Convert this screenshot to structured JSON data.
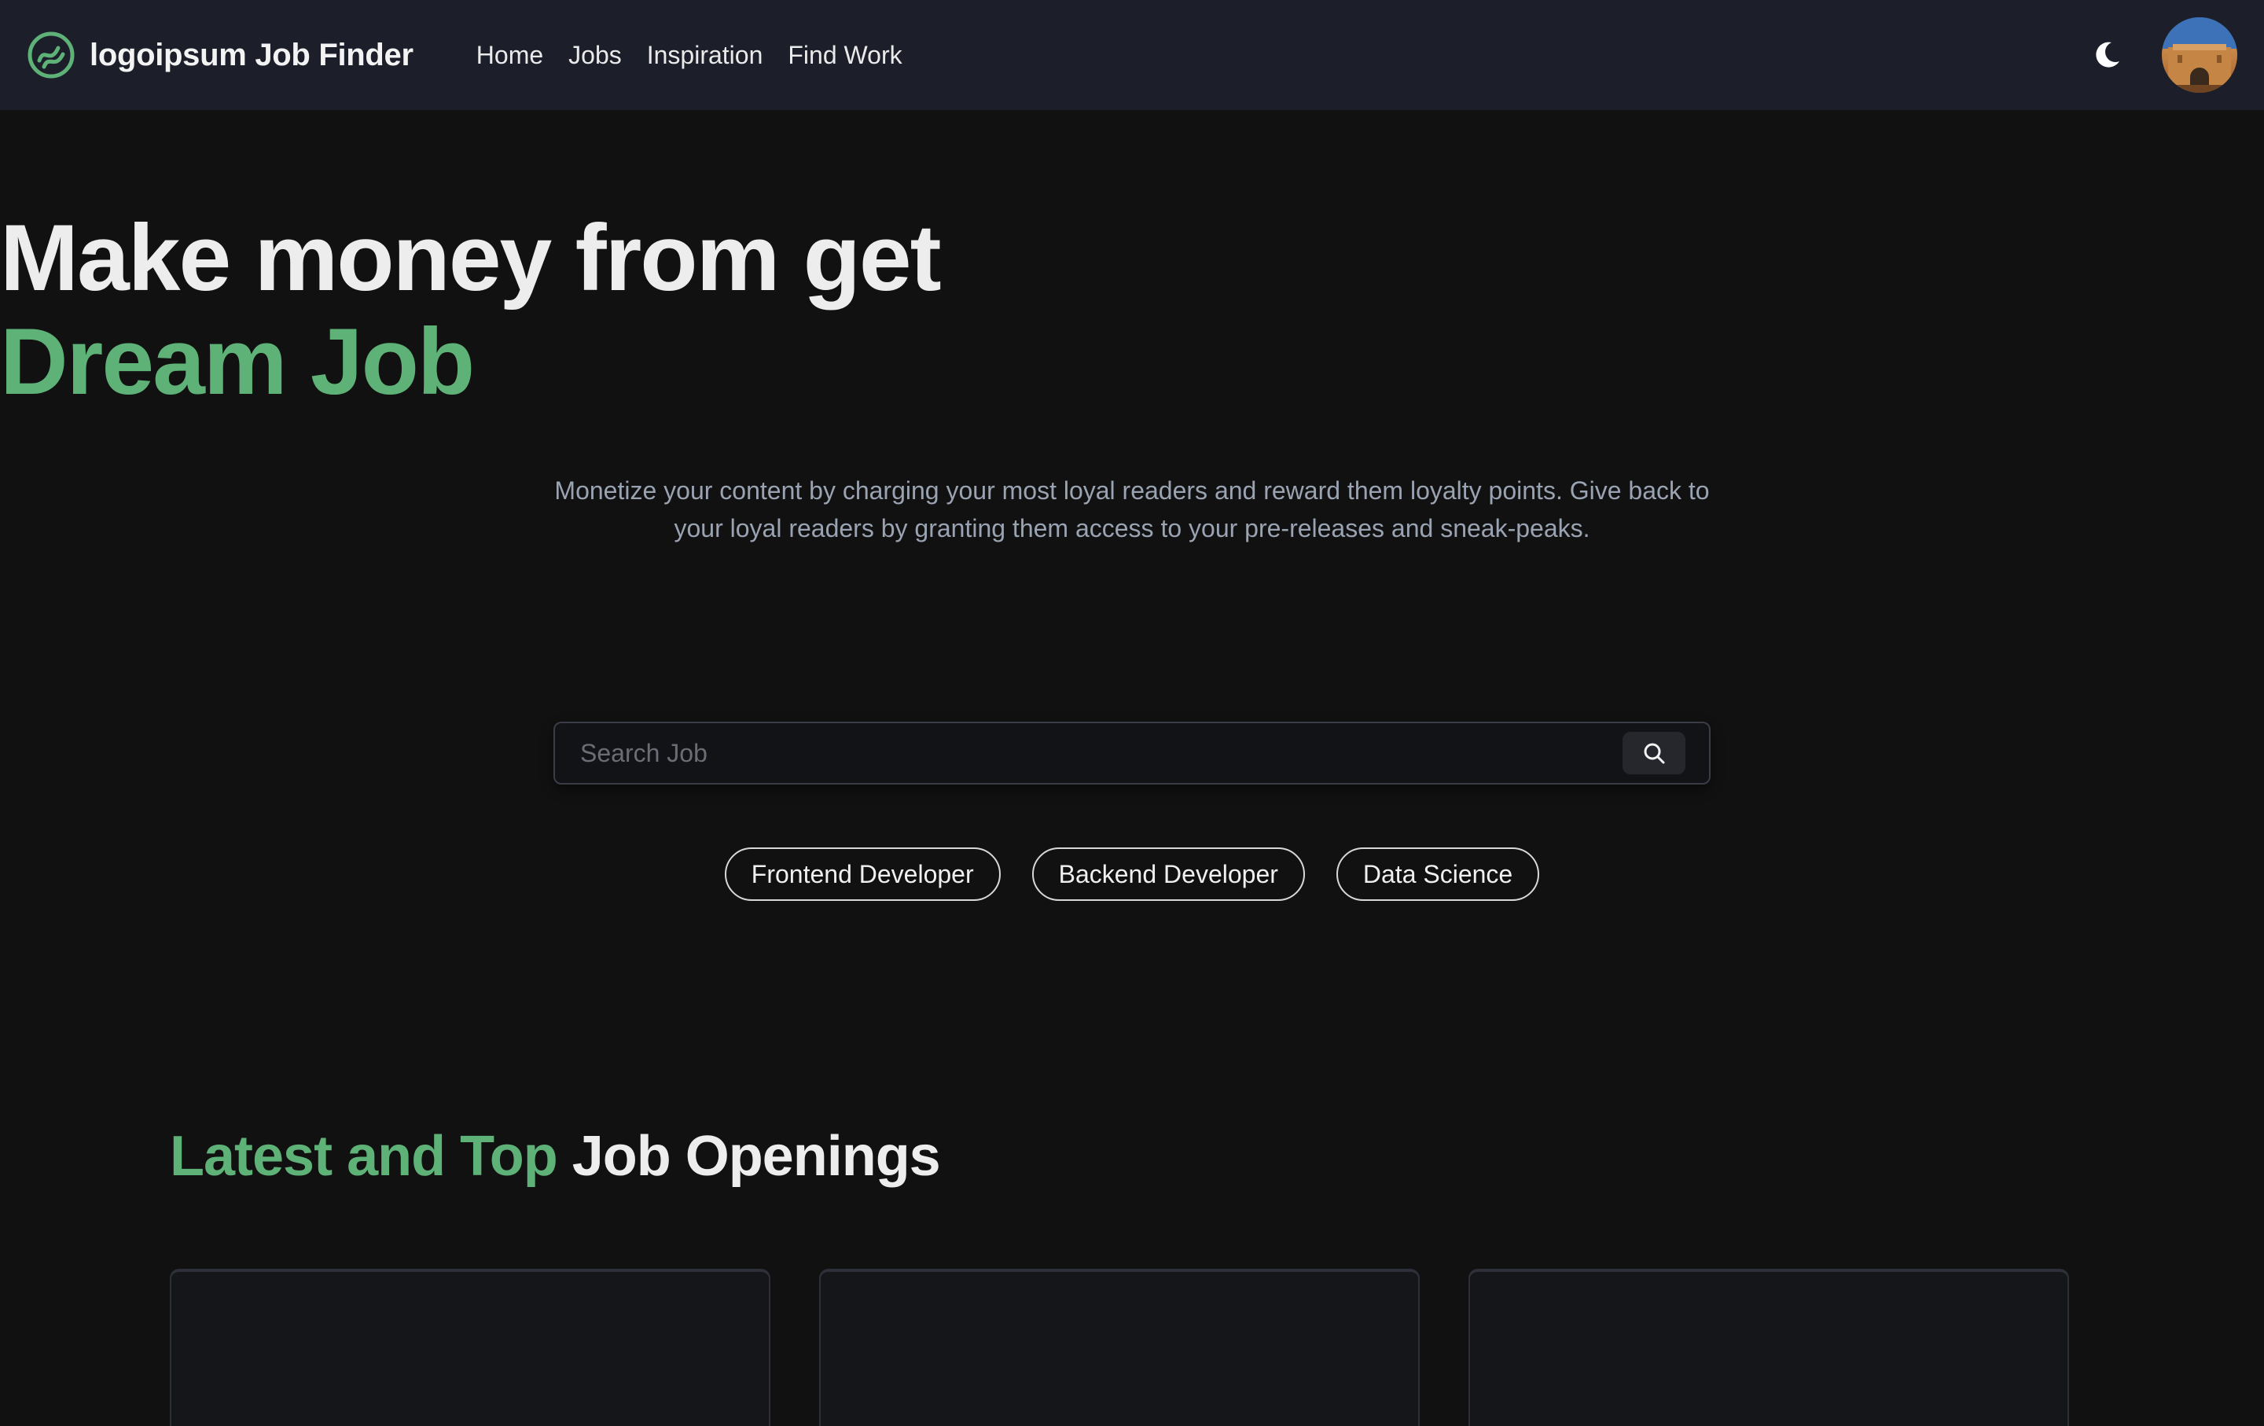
{
  "header": {
    "brand": "logoipsum Job Finder",
    "nav": [
      {
        "label": "Home"
      },
      {
        "label": "Jobs"
      },
      {
        "label": "Inspiration"
      },
      {
        "label": "Find Work"
      }
    ],
    "theme_icon": "moon-icon",
    "avatar_icon": "user-avatar"
  },
  "hero": {
    "title_line1": "Make money from get",
    "title_line2": "Dream Job",
    "description": "Monetize your content by charging your most loyal readers and reward them loyalty points. Give back to your loyal readers by granting them access to your pre-releases and sneak-peaks."
  },
  "search": {
    "placeholder": "Search Job",
    "value": "",
    "button_icon": "search-icon"
  },
  "chips": [
    {
      "label": "Frontend Developer"
    },
    {
      "label": "Backend Developer"
    },
    {
      "label": "Data Science"
    }
  ],
  "section": {
    "title_accent": "Latest and Top",
    "title_rest": "Job Openings"
  },
  "colors": {
    "background": "#111112",
    "navbar": "#1c1f2a",
    "accent": "#5fb277",
    "muted_text": "#9aa3b2"
  }
}
